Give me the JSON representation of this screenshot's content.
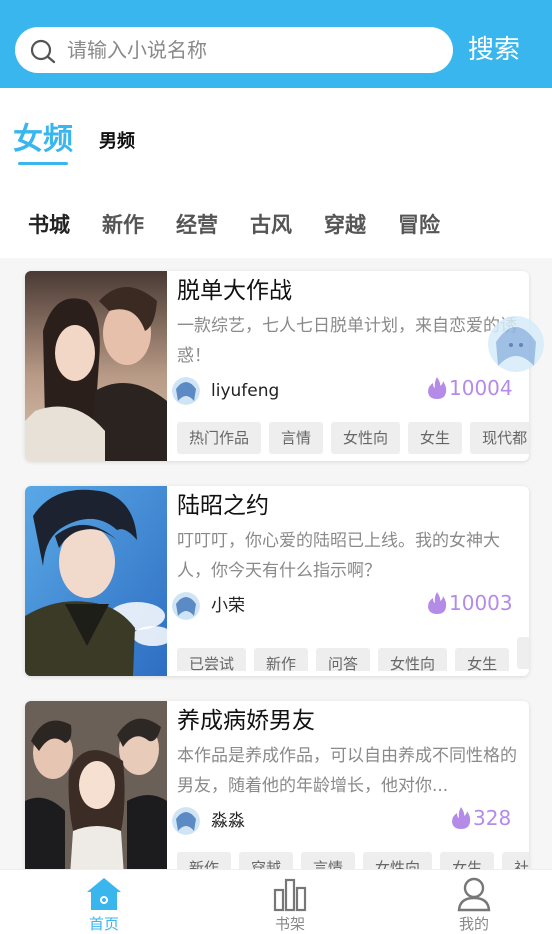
{
  "search": {
    "placeholder": "请输入小说名称",
    "button_label": "搜索"
  },
  "gender_tabs": {
    "female": "女频",
    "male": "男频"
  },
  "categories": [
    "书城",
    "新作",
    "经营",
    "古风",
    "穿越",
    "冒险"
  ],
  "books": [
    {
      "title": "脱单大作战",
      "description": "一款综艺，七人七日脱单计划，来自恋爱的诱惑！",
      "author": "liyufeng",
      "heat": "10004",
      "tags": [
        "热门作品",
        "言情",
        "女性向",
        "女生",
        "现代都"
      ]
    },
    {
      "title": "陆昭之约",
      "description": "叮叮叮，你心爱的陆昭已上线。我的女神大人，你今天有什么指示啊？",
      "author": "小荣",
      "heat": "10003",
      "tags": [
        "已尝试",
        "新作",
        "问答",
        "女性向",
        "女生",
        ""
      ]
    },
    {
      "title": "养成病娇男友",
      "description": "本作品是养成作品，可以自由养成不同性格的男友，随着他的年龄增长，他对你...",
      "author": "淼淼",
      "heat": "328",
      "tags": [
        "新作",
        "穿越",
        "言情",
        "女性向",
        "女生",
        "社"
      ]
    }
  ],
  "bottom_nav": {
    "home": "首页",
    "shelf": "书架",
    "mine": "我的"
  },
  "colors": {
    "accent": "#3ab6ef",
    "heat": "#b48ce8"
  }
}
